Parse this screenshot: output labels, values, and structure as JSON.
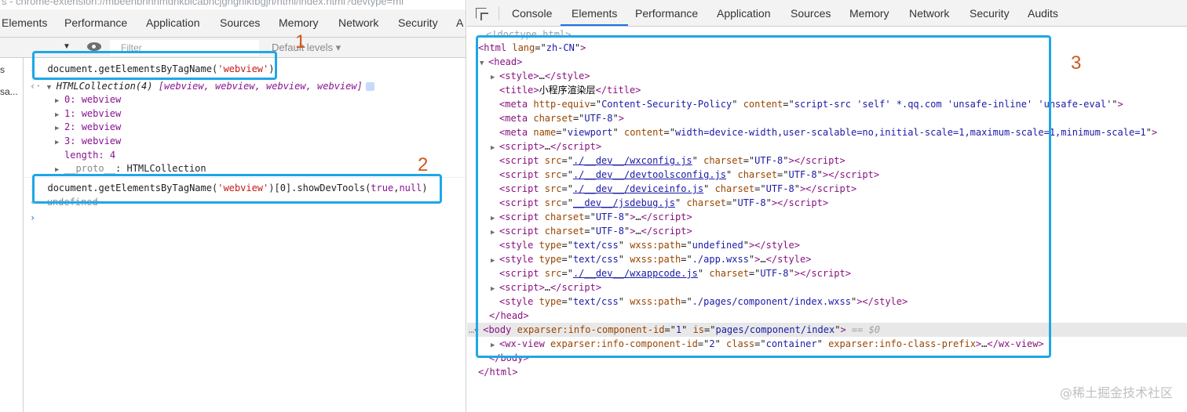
{
  "left": {
    "title_bar": "s - chrome-extension://mbeenbnhnmdhkbicabncjghgnikfbgjh/html/index.html?devtype=mi",
    "tabs": [
      "Elements",
      "Performance",
      "Application",
      "Sources",
      "Memory",
      "Network",
      "Security",
      "A"
    ],
    "toolbar": {
      "filter_placeholder": "Filter",
      "levels": "Default levels"
    },
    "sidebar": [
      "s",
      "sa..."
    ],
    "console": {
      "cmd1": "document.getElementsByTagName('webview')",
      "cmd1_prefix": "document.getElementsByTagName(",
      "cmd1_arg": "'webview'",
      "cmd1_suffix": ")",
      "collection_header": "HTMLCollection(4)",
      "collection_items": "[webview, webview, webview, webview]",
      "items": [
        {
          "index": "0:",
          "value": "webview"
        },
        {
          "index": "1:",
          "value": "webview"
        },
        {
          "index": "2:",
          "value": "webview"
        },
        {
          "index": "3:",
          "value": "webview"
        }
      ],
      "length_key": "length:",
      "length_val": "4",
      "proto_key": "__proto__",
      "proto_val": ": HTMLCollection",
      "cmd2_prefix": "document.getElementsByTagName(",
      "cmd2_arg": "'webview'",
      "cmd2_mid": ")[0].showDevTools(",
      "cmd2_true": "true",
      "cmd2_comma": ",",
      "cmd2_null": "null",
      "cmd2_suffix": ")",
      "result": "undefined"
    }
  },
  "right": {
    "tabs": [
      "Console",
      "Elements",
      "Performance",
      "Application",
      "Sources",
      "Memory",
      "Network",
      "Security",
      "Audits"
    ],
    "active_tab": "Elements",
    "dom": {
      "doctype": "<!doctype html>",
      "html_lang": "zh-CN",
      "title": "小程序渲染层",
      "csp_content": "script-src 'self' *.qq.com 'unsafe-inline' 'unsafe-eval'",
      "charset": "UTF-8",
      "viewport_content": "width=device-width,user-scalable=no,initial-scale=1,maximum-scale=1,minimum-scale=1",
      "scripts": [
        "./__dev__/wxconfig.js",
        "./__dev__/devtoolsconfig.js",
        "./__dev__/deviceinfo.js",
        "__dev__/jsdebug.js"
      ],
      "style_path_undefined": "undefined",
      "style_path_app": "./app.wxss",
      "script_wxappcode": "./__dev__/wxappcode.js",
      "style_path_page": "./pages/component/index.wxss",
      "body_component_id": "1",
      "body_is": "pages/component/index",
      "body_suffix": "== $0",
      "wxview_component_id": "2",
      "wxview_class": "container"
    }
  },
  "annotations": [
    "1",
    "2",
    "3"
  ],
  "watermark": "@稀土掘金技术社区",
  "colors": {
    "highlight": "#1ea7e6",
    "annotation": "#d0571c",
    "tab_active": "#1a73e8"
  }
}
